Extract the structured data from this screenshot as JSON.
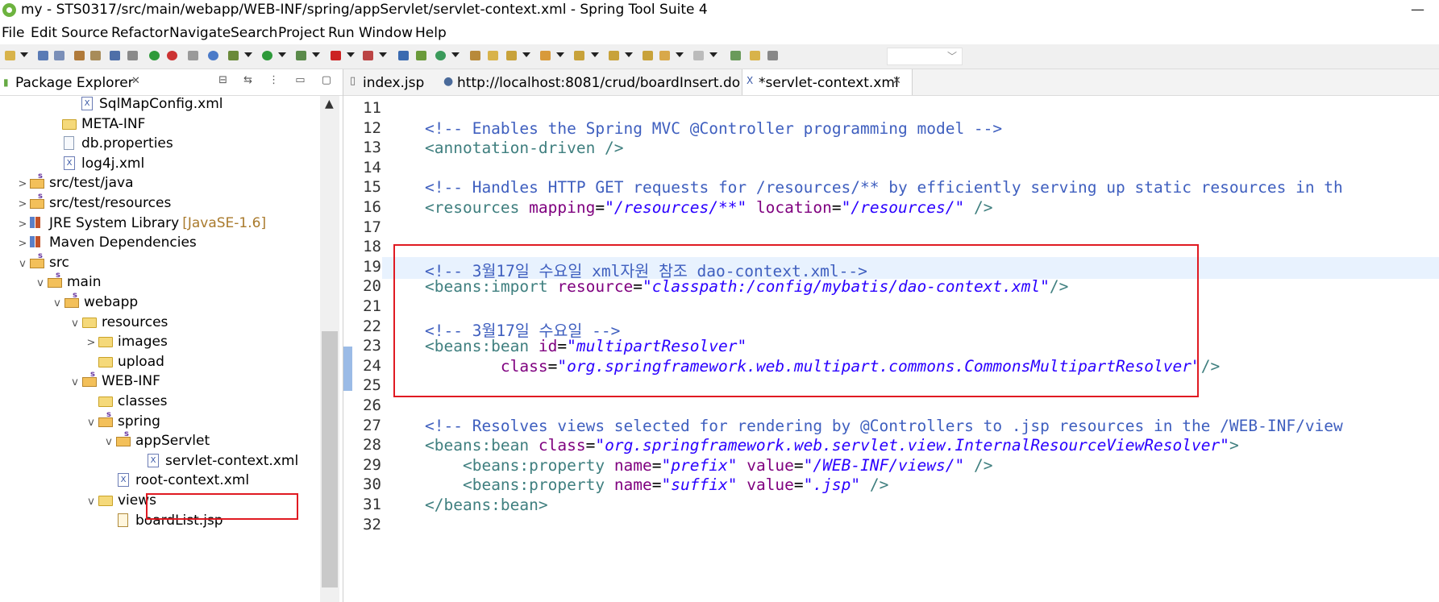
{
  "window": {
    "title": "my - STS0317/src/main/webapp/WEB-INF/spring/appServlet/servlet-context.xml - Spring Tool Suite 4",
    "minimize": "—"
  },
  "menu": [
    "File",
    "Edit",
    "Source",
    "Refactor",
    "Navigate",
    "Search",
    "Project",
    "Run",
    "Window",
    "Help"
  ],
  "explorer": {
    "tab_label": "Package Explorer",
    "tab_close": "✕",
    "actions": "⊟ ⇆ ⋮ ▭ ▢",
    "scroll_up": "▲",
    "items": [
      {
        "label": "SqlMapConfig.xml",
        "icon": "xml-file-icon",
        "chevron": ""
      },
      {
        "label": "META-INF",
        "icon": "folder-icon",
        "chevron": ""
      },
      {
        "label": "db.properties",
        "icon": "file-icon",
        "chevron": ""
      },
      {
        "label": "log4j.xml",
        "icon": "xml-file-icon",
        "chevron": ""
      },
      {
        "label": "src/test/java",
        "icon": "package-folder-icon",
        "chevron": ">"
      },
      {
        "label": "src/test/resources",
        "icon": "package-folder-icon",
        "chevron": ">"
      },
      {
        "label": "JRE System Library",
        "extra": "[JavaSE-1.6]",
        "icon": "library-icon",
        "chevron": ">"
      },
      {
        "label": "Maven Dependencies",
        "icon": "library-icon",
        "chevron": ">"
      },
      {
        "label": "src",
        "icon": "package-folder-icon",
        "chevron": "v"
      },
      {
        "label": "main",
        "icon": "package-folder-icon",
        "chevron": "v"
      },
      {
        "label": "webapp",
        "icon": "package-folder-icon",
        "chevron": "v"
      },
      {
        "label": "resources",
        "icon": "folder-icon",
        "chevron": "v"
      },
      {
        "label": "images",
        "icon": "folder-icon",
        "chevron": ">"
      },
      {
        "label": "upload",
        "icon": "folder-icon",
        "chevron": ""
      },
      {
        "label": "WEB-INF",
        "icon": "package-folder-icon",
        "chevron": "v"
      },
      {
        "label": "classes",
        "icon": "folder-icon",
        "chevron": ""
      },
      {
        "label": "spring",
        "icon": "package-folder-icon",
        "chevron": "v"
      },
      {
        "label": "appServlet",
        "icon": "package-folder-icon",
        "chevron": "v"
      },
      {
        "label": "servlet-context.xml",
        "icon": "spring-xml-icon",
        "chevron": "",
        "selected": true
      },
      {
        "label": "root-context.xml",
        "icon": "spring-xml-icon",
        "chevron": ""
      },
      {
        "label": "views",
        "icon": "folder-icon",
        "chevron": "v"
      },
      {
        "label": "boardList.jsp",
        "icon": "jsp-file-icon",
        "chevron": ""
      }
    ]
  },
  "editor": {
    "tabs": [
      {
        "label": "index.jsp",
        "icon": "jsp-icon"
      },
      {
        "label": "http://localhost:8081/crud/boardInsert.do",
        "icon": "globe-icon"
      },
      {
        "label": "*servlet-context.xml",
        "icon": "xml-icon",
        "active": true,
        "close": "✕"
      }
    ],
    "lines": [
      {
        "n": "11",
        "parts": []
      },
      {
        "n": "12",
        "parts": [
          [
            "c",
            "<!-- Enables the Spring MVC @Controller programming model -->"
          ]
        ]
      },
      {
        "n": "13",
        "parts": [
          [
            "t",
            "<annotation-driven />"
          ]
        ]
      },
      {
        "n": "14",
        "parts": []
      },
      {
        "n": "15",
        "parts": [
          [
            "c",
            "<!-- Handles HTTP GET requests for /resources/** by efficiently serving up static resources in th"
          ]
        ]
      },
      {
        "n": "16",
        "parts": [
          [
            "t",
            "<resources "
          ],
          [
            "a",
            "mapping"
          ],
          [
            "x",
            "="
          ],
          [
            "v",
            "\"/resources/**\""
          ],
          [
            "x",
            " "
          ],
          [
            "a",
            "location"
          ],
          [
            "x",
            "="
          ],
          [
            "v",
            "\"/resources/\""
          ],
          [
            "t",
            " />"
          ]
        ]
      },
      {
        "n": "17",
        "parts": []
      },
      {
        "n": "18",
        "parts": []
      },
      {
        "n": "19",
        "parts": [
          [
            "c",
            "<!-- 3월17일 수요일 xml자원 참조 dao-context.xml-->"
          ]
        ],
        "current": true
      },
      {
        "n": "20",
        "parts": [
          [
            "t",
            "<beans:import "
          ],
          [
            "a",
            "resource"
          ],
          [
            "x",
            "="
          ],
          [
            "v",
            "\"classpath:/config/mybatis/dao-context.xml\""
          ],
          [
            "t",
            "/>"
          ]
        ]
      },
      {
        "n": "21",
        "parts": []
      },
      {
        "n": "22",
        "parts": [
          [
            "c",
            "<!-- 3월17일 수요일 -->"
          ]
        ]
      },
      {
        "n": "23",
        "parts": [
          [
            "t",
            "<beans:bean "
          ],
          [
            "a",
            "id"
          ],
          [
            "x",
            "="
          ],
          [
            "v",
            "\"multipartResolver\""
          ]
        ]
      },
      {
        "n": "24",
        "parts": [
          [
            "x",
            "        "
          ],
          [
            "a",
            "class"
          ],
          [
            "x",
            "="
          ],
          [
            "v",
            "\"org.springframework.web.multipart.commons.CommonsMultipartResolver\""
          ],
          [
            "t",
            "/>"
          ]
        ]
      },
      {
        "n": "25",
        "parts": []
      },
      {
        "n": "26",
        "parts": []
      },
      {
        "n": "27",
        "parts": [
          [
            "c",
            "<!-- Resolves views selected for rendering by @Controllers to .jsp resources in the /WEB-INF/view"
          ]
        ]
      },
      {
        "n": "28",
        "parts": [
          [
            "t",
            "<beans:bean "
          ],
          [
            "a",
            "class"
          ],
          [
            "x",
            "="
          ],
          [
            "v",
            "\"org.springframework.web.servlet.view.InternalResourceViewResolver\""
          ],
          [
            "t",
            ">"
          ]
        ]
      },
      {
        "n": "29",
        "parts": [
          [
            "x",
            "    "
          ],
          [
            "t",
            "<beans:property "
          ],
          [
            "a",
            "name"
          ],
          [
            "x",
            "="
          ],
          [
            "v",
            "\"prefix\""
          ],
          [
            "x",
            " "
          ],
          [
            "a",
            "value"
          ],
          [
            "x",
            "="
          ],
          [
            "v",
            "\"/WEB-INF/views/\""
          ],
          [
            "t",
            " />"
          ]
        ]
      },
      {
        "n": "30",
        "parts": [
          [
            "x",
            "    "
          ],
          [
            "t",
            "<beans:property "
          ],
          [
            "a",
            "name"
          ],
          [
            "x",
            "="
          ],
          [
            "v",
            "\"suffix\""
          ],
          [
            "x",
            " "
          ],
          [
            "a",
            "value"
          ],
          [
            "x",
            "="
          ],
          [
            "v",
            "\".jsp\""
          ],
          [
            "t",
            " />"
          ]
        ]
      },
      {
        "n": "31",
        "parts": [
          [
            "t",
            "</beans:bean>"
          ]
        ]
      },
      {
        "n": "32",
        "parts": []
      }
    ]
  },
  "colors": {
    "comment": "#3f5fbf",
    "tag": "#3f7f7f",
    "attribute": "#7f007f",
    "value": "#2a00ff",
    "highlight_box": "#e01a22",
    "current_line": "#e8f2fe"
  }
}
